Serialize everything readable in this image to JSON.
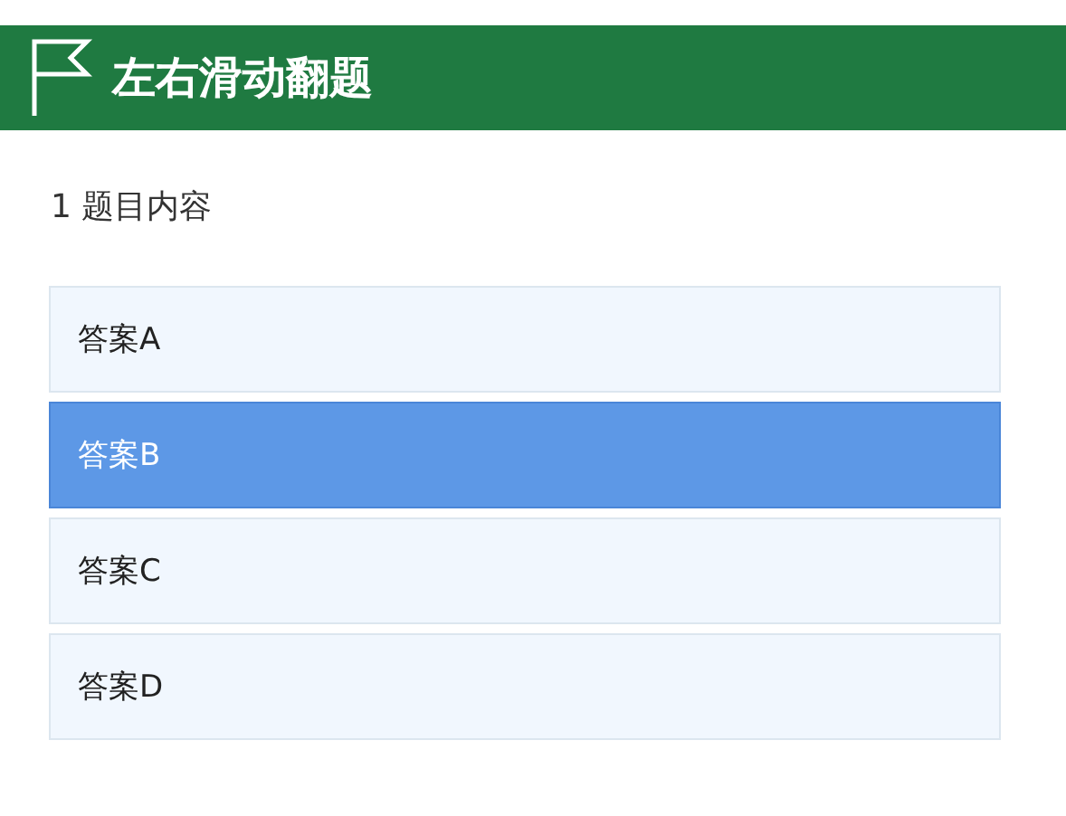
{
  "header": {
    "title": "左右滑动翻题"
  },
  "question": {
    "text": "1 题目内容"
  },
  "options": [
    {
      "label": "答案A",
      "selected": false
    },
    {
      "label": "答案B",
      "selected": true
    },
    {
      "label": "答案C",
      "selected": false
    },
    {
      "label": "答案D",
      "selected": false
    }
  ]
}
